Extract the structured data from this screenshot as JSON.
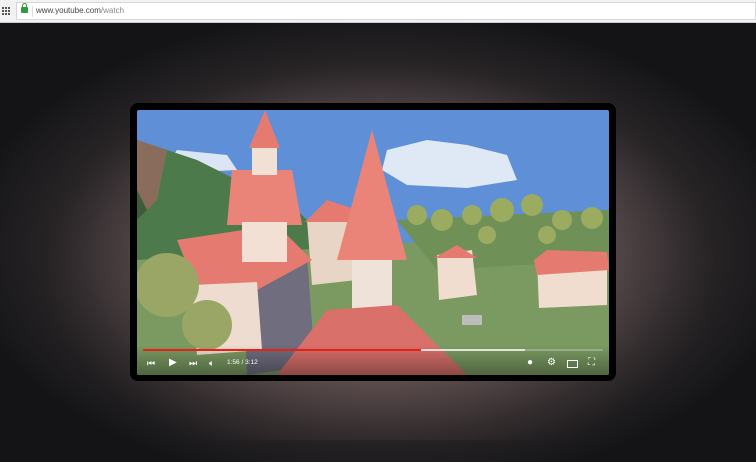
{
  "browser": {
    "url_host": "www.youtube.com",
    "url_path": "/watch"
  },
  "player": {
    "time_display": "1:56 / 3:12",
    "progress_fraction": 0.604,
    "buffer_fraction": 0.83,
    "accent": "#e62117",
    "icons": [
      "previous-icon",
      "play-icon",
      "next-icon",
      "volume-icon",
      "annotations-icon",
      "settings-icon",
      "theater-mode-icon",
      "fullscreen-icon"
    ]
  }
}
